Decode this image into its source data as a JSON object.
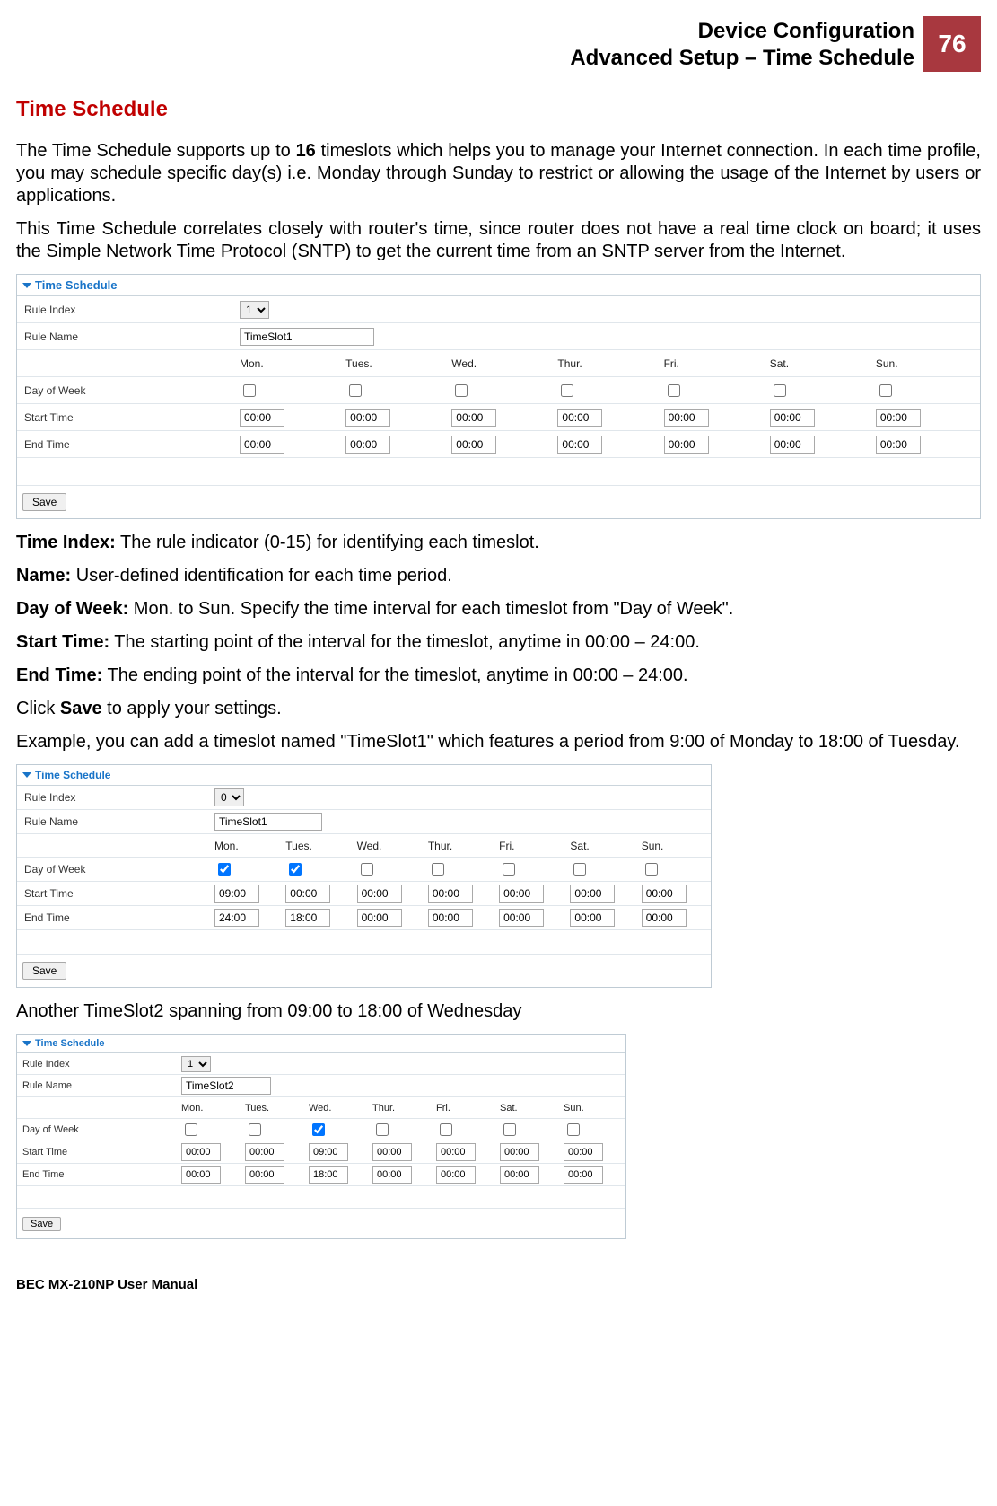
{
  "header": {
    "line1": "Device Configuration",
    "line2": "Advanced Setup – Time Schedule",
    "page_number": "76"
  },
  "section_title": "Time Schedule",
  "intro_paragraphs": [
    {
      "prefix": "The Time Schedule supports up to ",
      "bold1": "16",
      "suffix": " timeslots which helps you to manage your Internet connection. In each time profile, you may schedule specific day(s) i.e. Monday through Sunday to restrict or allowing the usage of the Internet by users or applications."
    },
    {
      "text": "This Time Schedule correlates closely with router's time, since router does not have a real time clock on board; it uses the Simple Network Time Protocol (SNTP) to get the current time from an SNTP server from the Internet."
    }
  ],
  "days": [
    "Mon.",
    "Tues.",
    "Wed.",
    "Thur.",
    "Fri.",
    "Sat.",
    "Sun."
  ],
  "field_labels": {
    "rule_index": "Rule Index",
    "rule_name": "Rule Name",
    "day_of_week": "Day of Week",
    "start_time": "Start Time",
    "end_time": "End Time"
  },
  "save_label": "Save",
  "panel1": {
    "title": "Time Schedule",
    "rule_index": "1",
    "rule_name": "TimeSlot1",
    "checked": [
      false,
      false,
      false,
      false,
      false,
      false,
      false
    ],
    "start": [
      "00:00",
      "00:00",
      "00:00",
      "00:00",
      "00:00",
      "00:00",
      "00:00"
    ],
    "end": [
      "00:00",
      "00:00",
      "00:00",
      "00:00",
      "00:00",
      "00:00",
      "00:00"
    ]
  },
  "definitions": [
    {
      "term": "Time Index:",
      "text": " The rule indicator (0-15) for identifying each timeslot."
    },
    {
      "term": "Name:",
      "text": " User-defined identification for each time period."
    },
    {
      "term": "Day of Week:",
      "text": " Mon. to Sun. Specify the time interval for each timeslot from \"Day of Week\"."
    },
    {
      "term": "Start Time:",
      "text": " The starting point of the interval for the timeslot, anytime in 00:00 – 24:00."
    },
    {
      "term": "End Time:",
      "text": " The ending point of the interval for the timeslot, anytime in 00:00 – 24:00."
    }
  ],
  "click_save_prefix": "Click ",
  "click_save_bold": "Save",
  "click_save_suffix": " to apply your settings.",
  "example_text": "Example, you can add a timeslot named \"TimeSlot1\" which features a period from 9:00 of Monday to 18:00 of Tuesday.",
  "panel2": {
    "title": "Time Schedule",
    "rule_index": "0",
    "rule_name": "TimeSlot1",
    "checked": [
      true,
      true,
      false,
      false,
      false,
      false,
      false
    ],
    "start": [
      "09:00",
      "00:00",
      "00:00",
      "00:00",
      "00:00",
      "00:00",
      "00:00"
    ],
    "end": [
      "24:00",
      "18:00",
      "00:00",
      "00:00",
      "00:00",
      "00:00",
      "00:00"
    ]
  },
  "another_text": "Another TimeSlot2 spanning from 09:00 to 18:00 of Wednesday",
  "panel3": {
    "title": "Time Schedule",
    "rule_index": "1",
    "rule_name": "TimeSlot2",
    "checked": [
      false,
      false,
      true,
      false,
      false,
      false,
      false
    ],
    "start": [
      "00:00",
      "00:00",
      "09:00",
      "00:00",
      "00:00",
      "00:00",
      "00:00"
    ],
    "end": [
      "00:00",
      "00:00",
      "18:00",
      "00:00",
      "00:00",
      "00:00",
      "00:00"
    ]
  },
  "footer": "BEC MX-210NP User Manual"
}
